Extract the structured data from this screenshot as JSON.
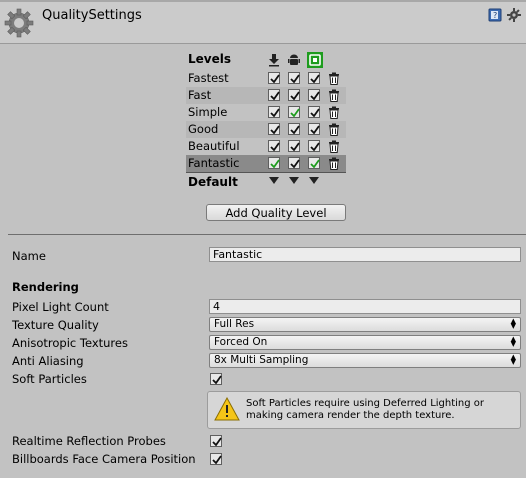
{
  "header": {
    "title": "QualitySettings"
  },
  "levels": {
    "header_label": "Levels",
    "platforms": [
      "download-icon",
      "android-icon",
      "windows-store-icon"
    ],
    "rows": [
      {
        "name": "Fastest",
        "checks": [
          true,
          true,
          true
        ],
        "green": [
          false,
          false,
          false
        ],
        "style": "normal"
      },
      {
        "name": "Fast",
        "checks": [
          true,
          true,
          true
        ],
        "green": [
          false,
          false,
          false
        ],
        "style": "alt"
      },
      {
        "name": "Simple",
        "checks": [
          true,
          true,
          true
        ],
        "green": [
          false,
          true,
          false
        ],
        "style": "normal"
      },
      {
        "name": "Good",
        "checks": [
          true,
          true,
          true
        ],
        "green": [
          false,
          false,
          false
        ],
        "style": "alt"
      },
      {
        "name": "Beautiful",
        "checks": [
          true,
          true,
          true
        ],
        "green": [
          false,
          false,
          false
        ],
        "style": "normal"
      },
      {
        "name": "Fantastic",
        "checks": [
          true,
          true,
          true
        ],
        "green": [
          true,
          false,
          true
        ],
        "style": "sel"
      }
    ],
    "default_label": "Default",
    "add_button": "Add Quality Level"
  },
  "details": {
    "name_label": "Name",
    "name_value": "Fantastic",
    "rendering_header": "Rendering",
    "pixel_light_count_label": "Pixel Light Count",
    "pixel_light_count_value": "4",
    "texture_quality_label": "Texture Quality",
    "texture_quality_value": "Full Res",
    "anisotropic_label": "Anisotropic Textures",
    "anisotropic_value": "Forced On",
    "anti_aliasing_label": "Anti Aliasing",
    "anti_aliasing_value": "8x Multi Sampling",
    "soft_particles_label": "Soft Particles",
    "soft_particles_checked": true,
    "warning_text": "Soft Particles require using Deferred Lighting or making camera render the depth texture.",
    "reflection_probes_label": "Realtime Reflection Probes",
    "reflection_probes_checked": true,
    "billboards_label": "Billboards Face Camera Position",
    "billboards_checked": true
  },
  "colors": {
    "accent_green": "#1e9c1e",
    "selected_row": "#8a8a8a"
  }
}
